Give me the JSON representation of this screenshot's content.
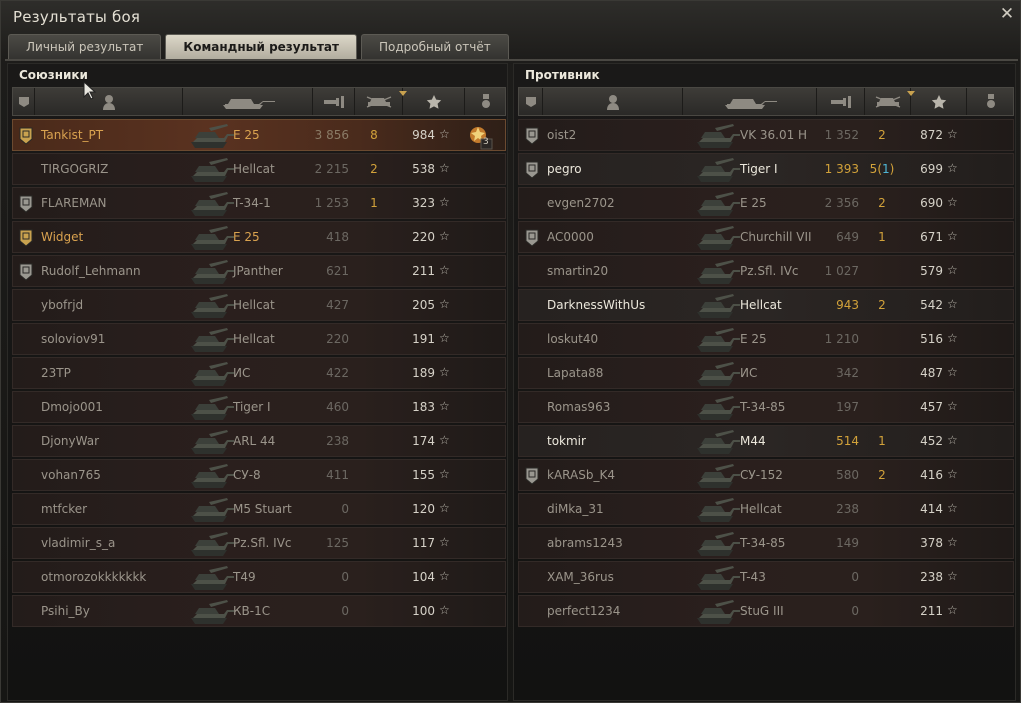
{
  "window": {
    "title": "Результаты боя",
    "close_glyph": "✕"
  },
  "tabs": [
    {
      "label": "Личный результат",
      "active": false
    },
    {
      "label": "Командный результат",
      "active": true
    },
    {
      "label": "Подробный отчёт",
      "active": false
    }
  ],
  "allies": {
    "title": "Союзники",
    "rows": [
      {
        "name": "Tankist_PT",
        "vehicle": "E 25",
        "damage": "3 856",
        "kills": "8",
        "xp": "984",
        "rank": "gold",
        "style": "me",
        "medal": "3"
      },
      {
        "name": "TIRGOGRIZ",
        "vehicle": "Hellcat",
        "damage": "2 215",
        "kills": "2",
        "xp": "538",
        "rank": "",
        "style": ""
      },
      {
        "name": "FLAREMAN",
        "vehicle": "T-34-1",
        "damage": "1 253",
        "kills": "1",
        "xp": "323",
        "rank": "silver",
        "style": ""
      },
      {
        "name": "Widget",
        "vehicle": "E 25",
        "damage": "418",
        "kills": "",
        "xp": "220",
        "rank": "gold",
        "style": "gold"
      },
      {
        "name": "Rudolf_Lehmann",
        "vehicle": "JPanther",
        "damage": "621",
        "kills": "",
        "xp": "211",
        "rank": "silver",
        "style": ""
      },
      {
        "name": "ybofrjd",
        "vehicle": "Hellcat",
        "damage": "427",
        "kills": "",
        "xp": "205",
        "rank": "",
        "style": ""
      },
      {
        "name": "soloviov91",
        "vehicle": "Hellcat",
        "damage": "220",
        "kills": "",
        "xp": "191",
        "rank": "",
        "style": ""
      },
      {
        "name": "23TP",
        "vehicle": "ИС",
        "damage": "422",
        "kills": "",
        "xp": "189",
        "rank": "",
        "style": ""
      },
      {
        "name": "Dmojo001",
        "vehicle": "Tiger I",
        "damage": "460",
        "kills": "",
        "xp": "183",
        "rank": "",
        "style": ""
      },
      {
        "name": "DjonyWar",
        "vehicle": "ARL 44",
        "damage": "238",
        "kills": "",
        "xp": "174",
        "rank": "",
        "style": ""
      },
      {
        "name": "vohan765",
        "vehicle": "СУ-8",
        "damage": "411",
        "kills": "",
        "xp": "155",
        "rank": "",
        "style": ""
      },
      {
        "name": "mtfcker",
        "vehicle": "M5 Stuart",
        "damage": "0",
        "kills": "",
        "xp": "120",
        "rank": "",
        "style": ""
      },
      {
        "name": "vladimir_s_a",
        "vehicle": "Pz.Sfl. IVc",
        "damage": "125",
        "kills": "",
        "xp": "117",
        "rank": "",
        "style": ""
      },
      {
        "name": "otmorozokkkkkkk",
        "vehicle": "T49",
        "damage": "0",
        "kills": "",
        "xp": "104",
        "rank": "",
        "style": ""
      },
      {
        "name": "Psihi_By",
        "vehicle": "КВ-1С",
        "damage": "0",
        "kills": "",
        "xp": "100",
        "rank": "",
        "style": ""
      }
    ]
  },
  "enemies": {
    "title": "Противник",
    "rows": [
      {
        "name": "oist2",
        "vehicle": "VK 36.01 H",
        "damage": "1 352",
        "kills": "2",
        "xp": "872",
        "rank": "silver",
        "style": ""
      },
      {
        "name": "pegro",
        "vehicle": "Tiger I",
        "damage": "1 393",
        "kills": "5",
        "kills_extra": "1",
        "xp": "699",
        "rank": "silver",
        "style": "alive"
      },
      {
        "name": "evgen2702",
        "vehicle": "E 25",
        "damage": "2 356",
        "kills": "2",
        "xp": "690",
        "rank": "",
        "style": ""
      },
      {
        "name": "AC0000",
        "vehicle": "Churchill VII",
        "damage": "649",
        "kills": "1",
        "xp": "671",
        "rank": "silver",
        "style": ""
      },
      {
        "name": "smartin20",
        "vehicle": "Pz.Sfl. IVc",
        "damage": "1 027",
        "kills": "",
        "xp": "579",
        "rank": "",
        "style": ""
      },
      {
        "name": "DarknessWithUs",
        "vehicle": "Hellcat",
        "damage": "943",
        "kills": "2",
        "xp": "542",
        "rank": "",
        "style": "alive"
      },
      {
        "name": "loskut40",
        "vehicle": "E 25",
        "damage": "1 210",
        "kills": "",
        "xp": "516",
        "rank": "",
        "style": ""
      },
      {
        "name": "Lapata88",
        "vehicle": "ИС",
        "damage": "342",
        "kills": "",
        "xp": "487",
        "rank": "",
        "style": ""
      },
      {
        "name": "Romas963",
        "vehicle": "T-34-85",
        "damage": "197",
        "kills": "",
        "xp": "457",
        "rank": "",
        "style": ""
      },
      {
        "name": "tokmir",
        "vehicle": "M44",
        "damage": "514",
        "kills": "1",
        "xp": "452",
        "rank": "",
        "style": "alive"
      },
      {
        "name": "kARASb_K4",
        "vehicle": "СУ-152",
        "damage": "580",
        "kills": "2",
        "xp": "416",
        "rank": "silver",
        "style": ""
      },
      {
        "name": "diMka_31",
        "vehicle": "Hellcat",
        "damage": "238",
        "kills": "",
        "xp": "414",
        "rank": "",
        "style": ""
      },
      {
        "name": "abrams1243",
        "vehicle": "T-34-85",
        "damage": "149",
        "kills": "",
        "xp": "378",
        "rank": "",
        "style": ""
      },
      {
        "name": "XAM_36rus",
        "vehicle": "T-43",
        "damage": "0",
        "kills": "",
        "xp": "238",
        "rank": "",
        "style": ""
      },
      {
        "name": "perfect1234",
        "vehicle": "StuG III",
        "damage": "0",
        "kills": "",
        "xp": "211",
        "rank": "",
        "style": ""
      }
    ]
  },
  "colors": {
    "accent_gold": "#d9a24f",
    "alive_white": "#ece8dc",
    "destroyed_grey": "#9b958b",
    "kills_yellow": "#d2a23a",
    "assist_blue": "#4fb6d6"
  },
  "icons": {
    "xp_star": "☆"
  }
}
